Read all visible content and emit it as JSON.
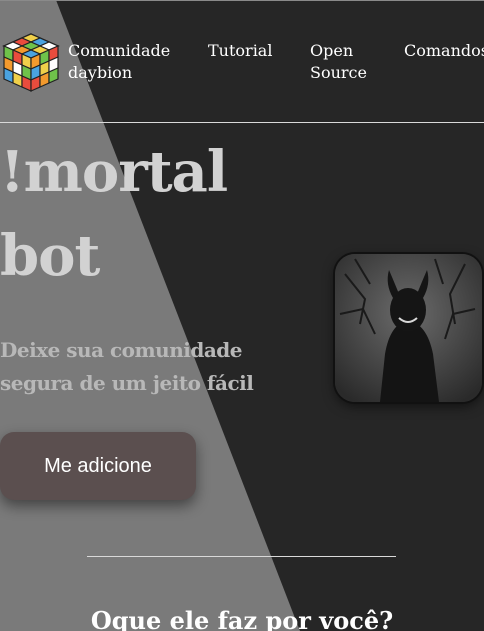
{
  "nav": {
    "items": [
      {
        "label": "Comunidade\ndaybion"
      },
      {
        "label": "Tutorial"
      },
      {
        "label": "Open\nSource"
      },
      {
        "label": "Comandos"
      }
    ]
  },
  "hero": {
    "title": "!mortal\nbot",
    "subtitle": "Deixe sua comunidade\nsegura de um jeito fácil",
    "add_button": "Me adicione"
  },
  "section": {
    "title": "Oque ele faz por você?"
  },
  "colors": {
    "background_dark": "#262626",
    "background_light": "#7a7a7a",
    "button": "#5b4f4f"
  },
  "icons": {
    "logo": "rubiks-cube-icon",
    "avatar": "bot-avatar-image"
  }
}
